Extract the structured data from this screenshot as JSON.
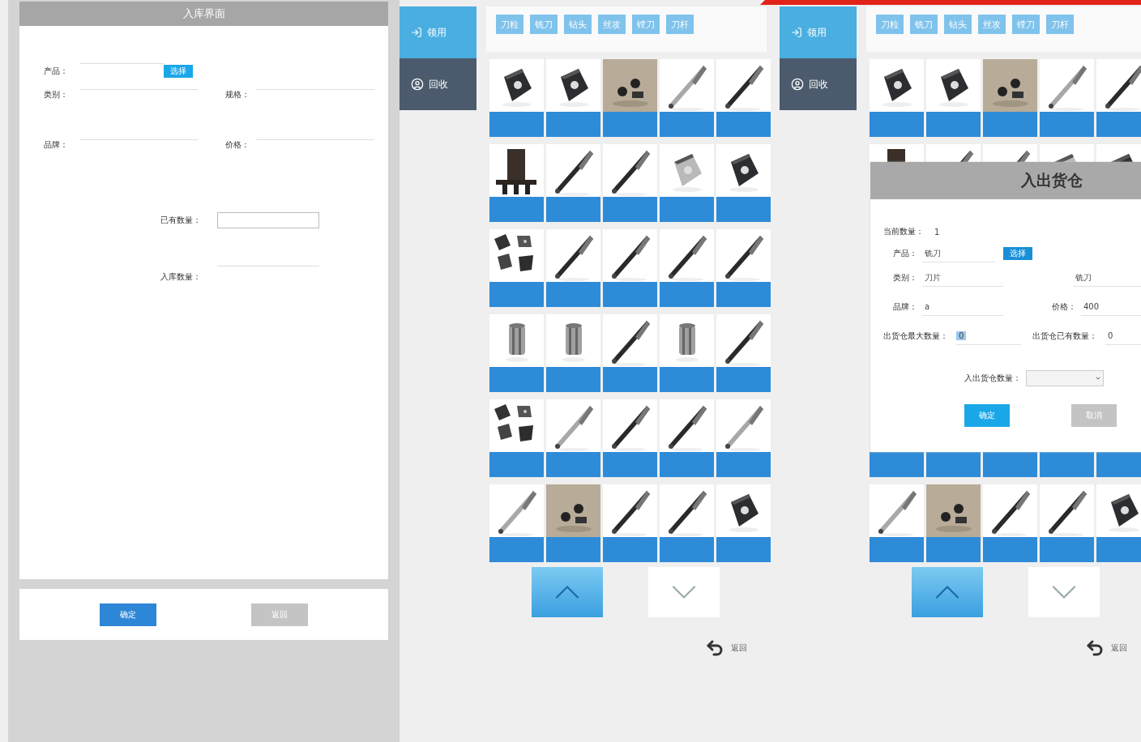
{
  "stock_in": {
    "title": "入库界面",
    "product": {
      "label": "产品："
    },
    "select_button": "选择",
    "fields": [
      {
        "label": "类别："
      },
      {
        "label": "规格："
      },
      {
        "label": "品牌："
      },
      {
        "label": "价格："
      }
    ],
    "existing_quantity": {
      "label": "已有数量："
    },
    "in_quantity": {
      "label": "入库数量："
    },
    "buttons": [
      {
        "label": "确定",
        "kind": "primary"
      },
      {
        "label": "返回",
        "kind": "secondary"
      }
    ]
  },
  "browsers": [
    {
      "sidebar": [
        {
          "label": "领用",
          "selected": true
        },
        {
          "label": "回收",
          "selected": false
        }
      ],
      "categories": [
        "刀粒",
        "铣刀",
        "钻头",
        "丝攻",
        "镗刀",
        "刀杆"
      ],
      "pager": [
        {
          "kind": "up",
          "active": true
        },
        {
          "kind": "down",
          "active": false
        }
      ],
      "back": "返回"
    },
    {
      "sidebar": [
        {
          "label": "领用",
          "selected": true
        },
        {
          "label": "回收",
          "selected": false
        }
      ],
      "categories": [
        "刀粒",
        "铣刀",
        "钻头",
        "丝攻",
        "镗刀",
        "刀杆"
      ],
      "pager": [
        {
          "kind": "up",
          "active": true
        },
        {
          "kind": "down",
          "active": false
        }
      ],
      "back": "返回",
      "dialog": {
        "title": "入出货仓",
        "current_quantity": {
          "label": "当前数量：",
          "value": "1"
        },
        "product": {
          "label": "产品：",
          "value": "铣刀"
        },
        "select_button": "选择",
        "fields": [
          {
            "label": "类别：",
            "value": "刀片",
            "highlighted": false
          },
          {
            "value": "铣刀",
            "highlighted": false
          },
          {
            "label": "品牌：",
            "value": "a",
            "highlighted": false
          },
          {
            "label": "价格：",
            "value": "400",
            "highlighted": false
          },
          {
            "label": "出货仓最大数量：",
            "value": "0",
            "highlighted": true
          },
          {
            "label": "出货仓已有数量：",
            "value": "0",
            "highlighted": false
          }
        ],
        "quantity_select": {
          "label": "入出货仓数量："
        },
        "buttons": [
          {
            "label": "确定",
            "kind": "primary"
          },
          {
            "label": "取消",
            "kind": "secondary"
          }
        ]
      }
    }
  ]
}
